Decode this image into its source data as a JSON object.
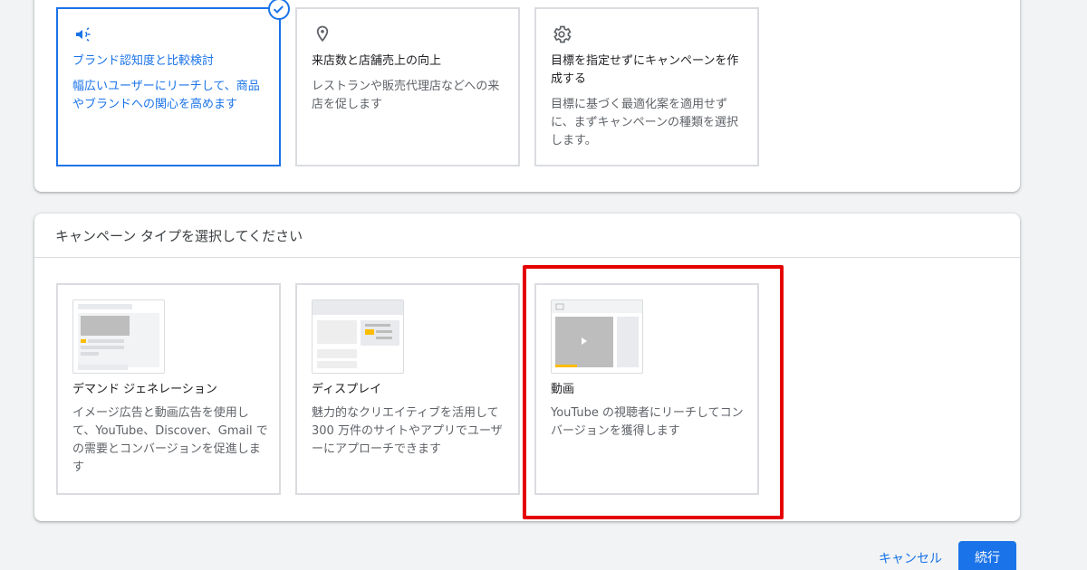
{
  "goals": [
    {
      "id": "awareness",
      "title": "ブランド認知度と比較検討",
      "description": "幅広いユーザーにリーチして、商品やブランドへの関心を高めます",
      "icon": "megaphone-icon",
      "selected": true
    },
    {
      "id": "store",
      "title": "来店数と店舗売上の向上",
      "description": "レストランや販売代理店などへの来店を促します",
      "icon": "location-pin-icon",
      "selected": false
    },
    {
      "id": "none",
      "title": "目標を指定せずにキャンペーンを作成する",
      "description": "目標に基づく最適化案を適用せずに、まずキャンペーンの種類を選択します。",
      "icon": "gear-icon",
      "selected": false
    }
  ],
  "campaign_types": {
    "header": "キャンペーン タイプを選択してください",
    "items": [
      {
        "id": "demand",
        "title": "デマンド ジェネレーション",
        "description": "イメージ広告と動画広告を使用して、YouTube、Discover、Gmail での需要とコンバージョンを促進します"
      },
      {
        "id": "display",
        "title": "ディスプレイ",
        "description": "魅力的なクリエイティブを活用して 300 万件のサイトやアプリでユーザーにアプローチできます"
      },
      {
        "id": "video",
        "title": "動画",
        "description": "YouTube の視聴者にリーチしてコンバージョンを獲得します"
      }
    ]
  },
  "footer": {
    "cancel_label": "キャンセル",
    "continue_label": "続行"
  },
  "colors": {
    "accent": "#1a73e8",
    "highlight": "#e50000",
    "thumb_yellow": "#fbbc04"
  }
}
